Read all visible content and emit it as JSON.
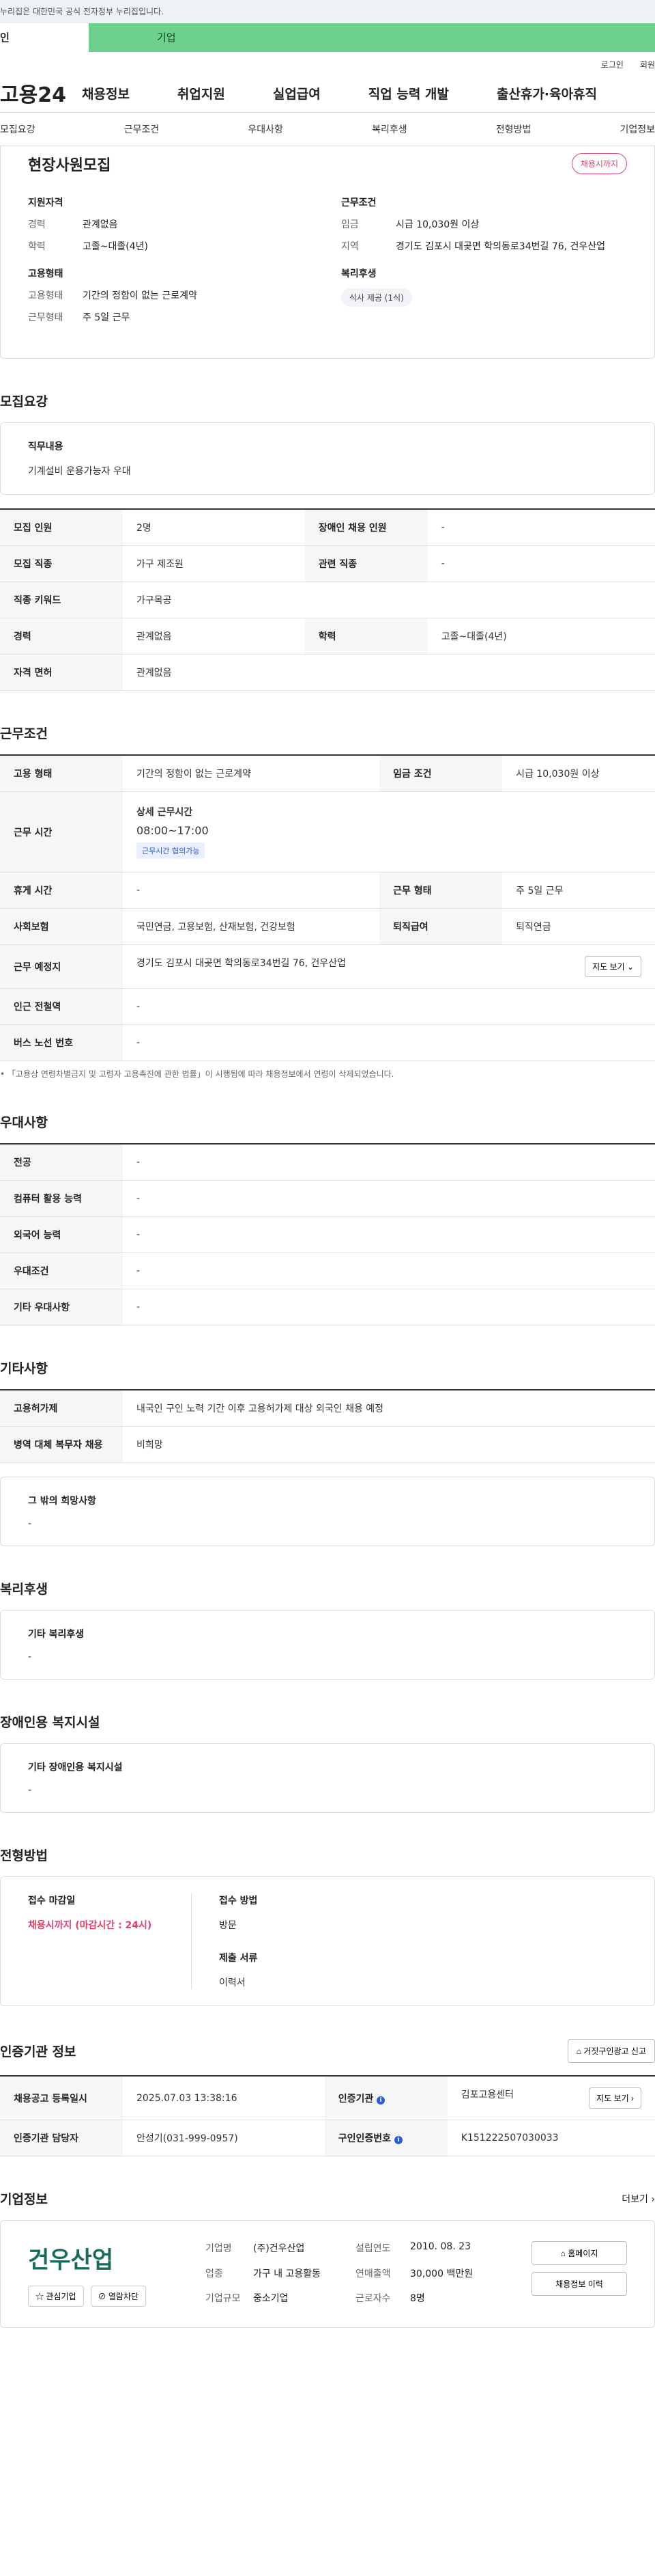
{
  "topbar": {
    "text": "누리집은 대한민국 공식 전자정부 누리집입니다."
  },
  "user_tabs": {
    "person": "인",
    "company": "기업"
  },
  "top_links": [
    "로그인",
    "회원"
  ],
  "brand": {
    "logo": "고용24"
  },
  "gnb": [
    "채용정보",
    "취업지원",
    "실업급여",
    "직업 능력 개발",
    "출산휴가·육아휴직"
  ],
  "subnav": [
    "모집요강",
    "근무조건",
    "우대사항",
    "복리후생",
    "전형방법",
    "기업정보"
  ],
  "summary": {
    "title": "현장사원모집",
    "badge": "채용시까지",
    "qual_heading": "지원자격",
    "qual": [
      {
        "k": "경력",
        "v": "관계없음"
      },
      {
        "k": "학력",
        "v": "고졸~대졸(4년)"
      }
    ],
    "cond_heading": "근무조건",
    "cond": [
      {
        "k": "임금",
        "v": "시급 10,030원 이상"
      },
      {
        "k": "지역",
        "v": "경기도 김포시 대곶면 학의동로34번길 76, 건우산업"
      }
    ],
    "emp_heading": "고용형태",
    "emp": [
      {
        "k": "고용형태",
        "v": "기간의 정함이 없는 근로계약"
      },
      {
        "k": "근무형태",
        "v": "주 5일 근무"
      }
    ],
    "welfare_heading": "복리후생",
    "welfare_tag": "식사 제공 (1식)"
  },
  "recruit": {
    "heading": "모집요강",
    "duty_label": "직무내용",
    "duty_value": "기계설비 운용가능자 우대",
    "rows": [
      {
        "k1": "모집 인원",
        "v1": "2명",
        "k2": "장애인 채용 인원",
        "v2": "-"
      },
      {
        "k1": "모집 직종",
        "v1": "가구 제조원",
        "k2": "관련 직종",
        "v2": "-"
      },
      {
        "k1": "직종 키워드",
        "v1": "가구목공"
      },
      {
        "k1": "경력",
        "v1": "관계없음",
        "k2": "학력",
        "v2": "고졸~대졸(4년)"
      },
      {
        "k1": "자격 면허",
        "v1": "관계없음"
      }
    ]
  },
  "work": {
    "heading": "근무조건",
    "employment_type_label": "고용 형태",
    "employment_type": "기간의 정함이 없는 근로계약",
    "wage_label": "임금 조건",
    "wage": "시급 10,030원 이상",
    "hours_label": "근무 시간",
    "hours_title": "상세 근무시간",
    "hours": "08:00~17:00",
    "hours_badge": "근무시간 협의가능",
    "break_label": "휴게 시간",
    "break": "-",
    "shift_label": "근무 형태",
    "shift": "주 5일 근무",
    "insurance_label": "사회보험",
    "insurance": "국민연금, 고용보험, 산재보험, 건강보험",
    "severance_label": "퇴직급여",
    "severance": "퇴직연금",
    "location_label": "근무 예정지",
    "location": "경기도 김포시 대곶면 학의동로34번길 76, 건우산업",
    "map_btn": "지도 보기",
    "subway_label": "인근 전철역",
    "subway": "-",
    "bus_label": "버스 노선 번호",
    "bus": "-",
    "note": "「고용상 연령차별금지 및 고령자 고용촉진에 관한 법률」이 시행됨에 따라 채용정보에서 연령이 삭제되었습니다."
  },
  "prefer": {
    "heading": "우대사항",
    "rows": [
      {
        "k": "전공",
        "v": "-"
      },
      {
        "k": "컴퓨터 활용 능력",
        "v": "-"
      },
      {
        "k": "외국어 능력",
        "v": "-"
      },
      {
        "k": "우대조건",
        "v": "-"
      },
      {
        "k": "기타 우대사항",
        "v": "-"
      }
    ]
  },
  "etc": {
    "heading": "기타사항",
    "rows": [
      {
        "k": "고용허가제",
        "v": "내국인 구인 노력 기간 이후 고용허가제 대상 외국인 채용 예정"
      },
      {
        "k": "병역 대체 복무자 채용",
        "v": "비희망"
      }
    ],
    "other_label": "그 밖의 희망사항",
    "other_value": "-"
  },
  "welfare": {
    "heading": "복리후생",
    "label": "기타 복리후생",
    "value": "-"
  },
  "disability": {
    "heading": "장애인용 복지시설",
    "label": "기타 장애인용 복지시설",
    "value": "-"
  },
  "selection": {
    "heading": "전형방법",
    "deadline_label": "접수 마감일",
    "deadline": "채용시까지 (마감시간 : 24시)",
    "method_label": "접수 방법",
    "method": "방문",
    "docs_label": "제출 서류",
    "docs": "이력서"
  },
  "agency": {
    "heading": "인증기관 정보",
    "report_btn": "거짓구인광고 신고",
    "reg_date_label": "채용공고 등록일시",
    "reg_date": "2025.07.03 13:38:16",
    "agency_label": "인증기관",
    "agency": "김포고용센터",
    "map_btn": "지도 보기",
    "manager_label": "인증기관 담당자",
    "manager": "안성기(031-999-0957)",
    "cert_no_label": "구인인증번호",
    "cert_no": "K151222507030033",
    "info_icon": "i"
  },
  "company": {
    "heading": "기업정보",
    "more": "더보기",
    "logo_text": "건우산업",
    "fav_btn": "관심기업",
    "block_btn": "열람차단",
    "info": [
      {
        "k": "기업명",
        "v": "(주)건우산업",
        "k2": "설립연도",
        "v2": "2010. 08. 23"
      },
      {
        "k": "업종",
        "v": "가구 내 고용활동",
        "k2": "연매출액",
        "v2": "30,000 백만원"
      },
      {
        "k": "기업규모",
        "v": "중소기업",
        "k2": "근로자수",
        "v2": "8명"
      }
    ],
    "homepage_btn": "홈페이지",
    "history_btn": "채용정보 이력"
  }
}
